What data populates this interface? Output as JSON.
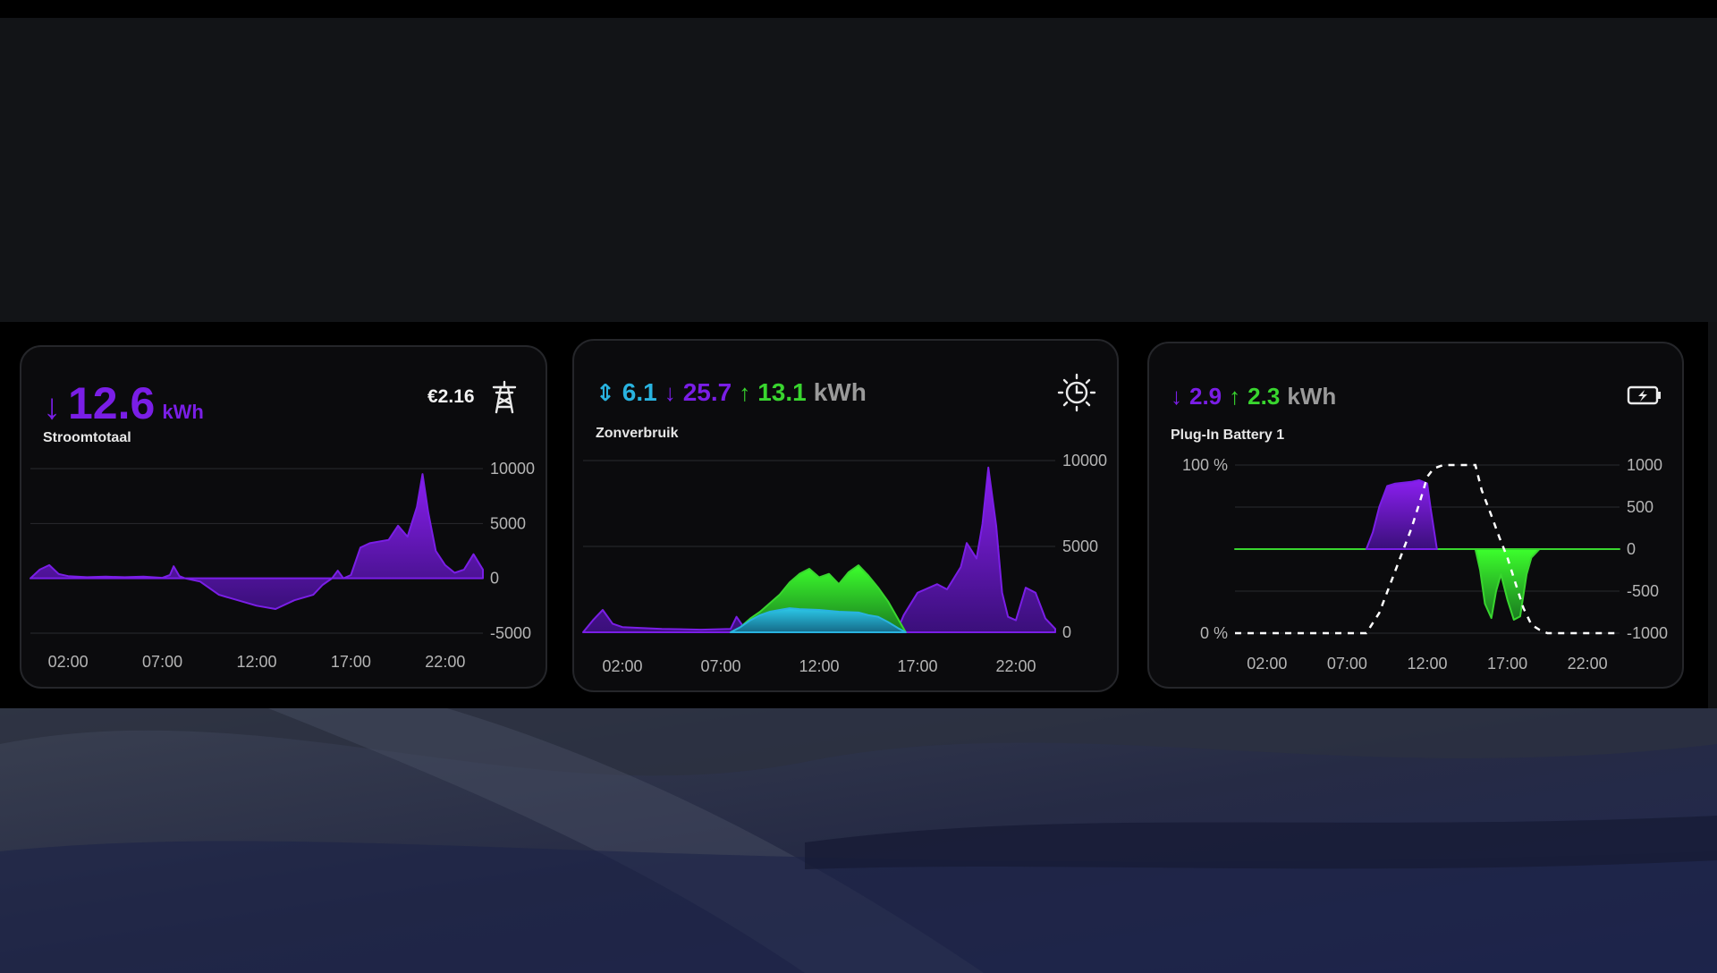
{
  "colors": {
    "purple": "#7a1ee6",
    "green": "#39d62f",
    "cyan": "#29b3e0",
    "grey": "#9a9a9a",
    "background": "#000000"
  },
  "cards": [
    {
      "id": "stroomtotaal",
      "icon": "power-pylon-icon",
      "price": "€2.16",
      "title": "Stroomtotaal",
      "stats": [
        {
          "arrow": "↓",
          "value": "12.6",
          "color": "purple"
        }
      ],
      "unit": "kWh",
      "unit_color": "purple",
      "chart_data": {
        "type": "area",
        "x_ticks": [
          "02:00",
          "07:00",
          "12:00",
          "17:00",
          "22:00"
        ],
        "y_ticks": [
          "10000",
          "5000",
          "0",
          "-5000"
        ],
        "ylim": [
          -5000,
          10000
        ],
        "grid": true,
        "series": [
          {
            "color": "purple",
            "points": [
              [
                0,
                0
              ],
              [
                0.5,
                800
              ],
              [
                1,
                1200
              ],
              [
                1.5,
                400
              ],
              [
                2,
                200
              ],
              [
                3,
                100
              ],
              [
                4,
                150
              ],
              [
                5,
                100
              ],
              [
                6,
                150
              ],
              [
                7,
                50
              ],
              [
                7.4,
                300
              ],
              [
                7.6,
                1100
              ],
              [
                7.9,
                200
              ],
              [
                8.2,
                0
              ],
              [
                9,
                -300
              ],
              [
                10,
                -1500
              ],
              [
                11,
                -2000
              ],
              [
                12,
                -2500
              ],
              [
                13,
                -2800
              ],
              [
                14,
                -2000
              ],
              [
                15,
                -1500
              ],
              [
                15.5,
                -600
              ],
              [
                16,
                0
              ],
              [
                16.3,
                700
              ],
              [
                16.6,
                0
              ],
              [
                17,
                300
              ],
              [
                17.5,
                2800
              ],
              [
                18,
                3200
              ],
              [
                19,
                3500
              ],
              [
                19.5,
                4800
              ],
              [
                20,
                3800
              ],
              [
                20.5,
                6500
              ],
              [
                20.8,
                9500
              ],
              [
                21.1,
                6000
              ],
              [
                21.5,
                2500
              ],
              [
                22,
                1200
              ],
              [
                22.5,
                500
              ],
              [
                23,
                800
              ],
              [
                23.5,
                2200
              ],
              [
                24,
                800
              ]
            ]
          }
        ]
      }
    },
    {
      "id": "zonverbruik",
      "icon": "solar-clock-icon",
      "title": "Zonverbruik",
      "stats": [
        {
          "arrow": "⇕",
          "value": "6.1",
          "color": "cyan"
        },
        {
          "arrow": "↓",
          "value": "25.7",
          "color": "purple"
        },
        {
          "arrow": "↑",
          "value": "13.1",
          "color": "green"
        }
      ],
      "unit": "kWh",
      "unit_color": "grey",
      "chart_data": {
        "type": "area",
        "x_ticks": [
          "02:00",
          "07:00",
          "12:00",
          "17:00",
          "22:00"
        ],
        "y_ticks": [
          "10000",
          "5000",
          "0"
        ],
        "ylim": [
          0,
          10000
        ],
        "grid": true,
        "series": [
          {
            "color": "purple",
            "points": [
              [
                0,
                0
              ],
              [
                0.5,
                700
              ],
              [
                1,
                1300
              ],
              [
                1.5,
                500
              ],
              [
                2,
                300
              ],
              [
                4,
                200
              ],
              [
                6,
                150
              ],
              [
                7.5,
                200
              ],
              [
                7.8,
                900
              ],
              [
                8.1,
                400
              ],
              [
                8.5,
                300
              ],
              [
                9,
                200
              ],
              [
                16,
                200
              ],
              [
                16.3,
                1000
              ],
              [
                17,
                2300
              ],
              [
                18,
                2800
              ],
              [
                18.5,
                2500
              ],
              [
                19.2,
                3800
              ],
              [
                19.5,
                5200
              ],
              [
                20,
                4300
              ],
              [
                20.3,
                6300
              ],
              [
                20.6,
                9600
              ],
              [
                21,
                6200
              ],
              [
                21.3,
                2300
              ],
              [
                21.6,
                900
              ],
              [
                22,
                700
              ],
              [
                22.5,
                2600
              ],
              [
                23,
                2300
              ],
              [
                23.5,
                800
              ],
              [
                24,
                200
              ]
            ]
          },
          {
            "color": "green",
            "points": [
              [
                7.5,
                0
              ],
              [
                8,
                300
              ],
              [
                8.5,
                800
              ],
              [
                9,
                1200
              ],
              [
                9.5,
                1700
              ],
              [
                10,
                2200
              ],
              [
                10.5,
                2900
              ],
              [
                11,
                3400
              ],
              [
                11.5,
                3700
              ],
              [
                12,
                3200
              ],
              [
                12.5,
                3400
              ],
              [
                13,
                2800
              ],
              [
                13.5,
                3500
              ],
              [
                14,
                3900
              ],
              [
                14.5,
                3300
              ],
              [
                15,
                2600
              ],
              [
                15.5,
                1800
              ],
              [
                16,
                800
              ],
              [
                16.4,
                0
              ]
            ]
          },
          {
            "color": "cyan",
            "points": [
              [
                7.5,
                0
              ],
              [
                8,
                300
              ],
              [
                8.5,
                700
              ],
              [
                9,
                1000
              ],
              [
                9.5,
                1200
              ],
              [
                10,
                1300
              ],
              [
                10.5,
                1400
              ],
              [
                11,
                1350
              ],
              [
                12,
                1300
              ],
              [
                13,
                1200
              ],
              [
                14,
                1150
              ],
              [
                14.5,
                1000
              ],
              [
                15,
                900
              ],
              [
                15.5,
                600
              ],
              [
                16,
                250
              ],
              [
                16.4,
                0
              ]
            ]
          }
        ]
      }
    },
    {
      "id": "plug-in-battery-1",
      "icon": "battery-charging-icon",
      "title": "Plug-In Battery 1",
      "stats": [
        {
          "arrow": "↓",
          "value": "2.9",
          "color": "purple"
        },
        {
          "arrow": "↑",
          "value": "2.3",
          "color": "green"
        }
      ],
      "unit": "kWh",
      "unit_color": "grey",
      "chart_data": {
        "type": "area",
        "x_ticks": [
          "02:00",
          "07:00",
          "12:00",
          "17:00",
          "22:00"
        ],
        "y_ticks": [
          "1000",
          "500",
          "0",
          "-500",
          "-1000"
        ],
        "y2_ticks": [
          "100 %",
          "0 %"
        ],
        "ylim": [
          -1000,
          1000
        ],
        "grid": true,
        "series": [
          {
            "color": "green",
            "points": [
              [
                0,
                0
              ],
              [
                24,
                0
              ]
            ]
          },
          {
            "color": "purple",
            "points": [
              [
                8.2,
                0
              ],
              [
                8.6,
                200
              ],
              [
                9,
                500
              ],
              [
                9.5,
                750
              ],
              [
                10,
                780
              ],
              [
                11,
                800
              ],
              [
                11.5,
                820
              ],
              [
                12,
                780
              ],
              [
                12.2,
                500
              ],
              [
                12.6,
                0
              ]
            ]
          },
          {
            "color": "green",
            "points": [
              [
                15,
                0
              ],
              [
                15.3,
                -250
              ],
              [
                15.6,
                -650
              ],
              [
                16,
                -820
              ],
              [
                16.3,
                -500
              ],
              [
                16.6,
                -300
              ],
              [
                17,
                -600
              ],
              [
                17.4,
                -840
              ],
              [
                17.8,
                -800
              ],
              [
                18.2,
                -300
              ],
              [
                18.5,
                -100
              ],
              [
                19,
                0
              ]
            ]
          }
        ],
        "soc_series": {
          "style": "dashed",
          "color": "#ffffff",
          "points": [
            [
              0,
              0
            ],
            [
              8.2,
              0
            ],
            [
              9,
              12
            ],
            [
              10,
              37
            ],
            [
              11,
              62
            ],
            [
              11.6,
              80
            ],
            [
              12,
              93
            ],
            [
              12.4,
              98
            ],
            [
              13,
              100
            ],
            [
              15,
              100
            ],
            [
              15.4,
              85
            ],
            [
              16,
              70
            ],
            [
              16.5,
              57
            ],
            [
              17,
              45
            ],
            [
              17.5,
              30
            ],
            [
              18,
              15
            ],
            [
              18.5,
              5
            ],
            [
              19,
              2
            ],
            [
              19.5,
              0
            ],
            [
              24,
              0
            ]
          ]
        }
      }
    }
  ]
}
